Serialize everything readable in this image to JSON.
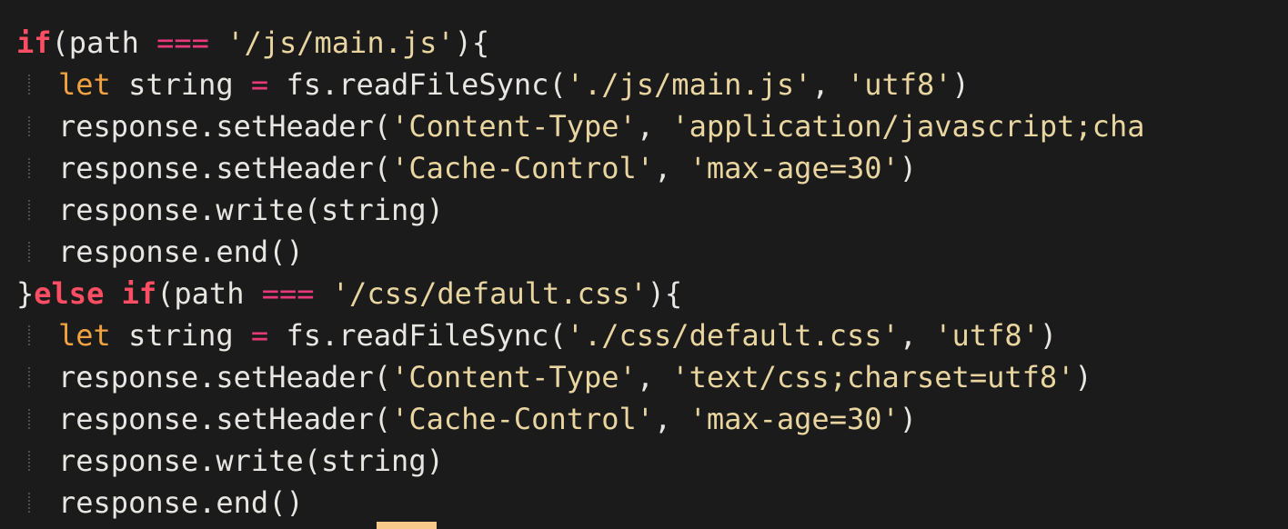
{
  "editor": {
    "lines": [
      {
        "indent": false,
        "tokens": [
          {
            "t": "kw",
            "v": "if"
          },
          {
            "t": "plain",
            "v": "(path "
          },
          {
            "t": "op",
            "v": "==="
          },
          {
            "t": "plain",
            "v": " "
          },
          {
            "t": "str",
            "v": "'/js/main.js'"
          },
          {
            "t": "plain",
            "v": "){"
          }
        ]
      },
      {
        "indent": true,
        "tokens": [
          {
            "t": "let",
            "v": "let"
          },
          {
            "t": "plain",
            "v": " string "
          },
          {
            "t": "op",
            "v": "="
          },
          {
            "t": "plain",
            "v": " fs.readFileSync("
          },
          {
            "t": "str",
            "v": "'./js/main.js'"
          },
          {
            "t": "plain",
            "v": ", "
          },
          {
            "t": "str",
            "v": "'utf8'"
          },
          {
            "t": "plain",
            "v": ")"
          }
        ]
      },
      {
        "indent": true,
        "tokens": [
          {
            "t": "plain",
            "v": "response.setHeader("
          },
          {
            "t": "str",
            "v": "'Content-Type'"
          },
          {
            "t": "plain",
            "v": ", "
          },
          {
            "t": "str",
            "v": "'application/javascript;cha"
          }
        ]
      },
      {
        "indent": true,
        "tokens": [
          {
            "t": "plain",
            "v": "response.setHeader("
          },
          {
            "t": "str",
            "v": "'Cache-Control'"
          },
          {
            "t": "plain",
            "v": ", "
          },
          {
            "t": "str",
            "v": "'max-age=30'"
          },
          {
            "t": "plain",
            "v": ")"
          }
        ]
      },
      {
        "indent": true,
        "tokens": [
          {
            "t": "plain",
            "v": "response.write(string)"
          }
        ]
      },
      {
        "indent": true,
        "tokens": [
          {
            "t": "plain",
            "v": "response.end()"
          }
        ]
      },
      {
        "indent": false,
        "tokens": [
          {
            "t": "plain",
            "v": "}"
          },
          {
            "t": "kw",
            "v": "else"
          },
          {
            "t": "plain",
            "v": " "
          },
          {
            "t": "kw",
            "v": "if"
          },
          {
            "t": "plain",
            "v": "(path "
          },
          {
            "t": "op",
            "v": "==="
          },
          {
            "t": "plain",
            "v": " "
          },
          {
            "t": "str",
            "v": "'/css/default.css'"
          },
          {
            "t": "plain",
            "v": "){"
          }
        ]
      },
      {
        "indent": true,
        "tokens": [
          {
            "t": "let",
            "v": "let"
          },
          {
            "t": "plain",
            "v": " string "
          },
          {
            "t": "op",
            "v": "="
          },
          {
            "t": "plain",
            "v": " fs.readFileSync("
          },
          {
            "t": "str",
            "v": "'./css/default.css'"
          },
          {
            "t": "plain",
            "v": ", "
          },
          {
            "t": "str",
            "v": "'utf8'"
          },
          {
            "t": "plain",
            "v": ")"
          }
        ]
      },
      {
        "indent": true,
        "tokens": [
          {
            "t": "plain",
            "v": "response.setHeader("
          },
          {
            "t": "str",
            "v": "'Content-Type'"
          },
          {
            "t": "plain",
            "v": ", "
          },
          {
            "t": "str",
            "v": "'text/css;charset=utf8'"
          },
          {
            "t": "plain",
            "v": ")"
          }
        ]
      },
      {
        "indent": true,
        "tokens": [
          {
            "t": "plain",
            "v": "response.setHeader("
          },
          {
            "t": "str",
            "v": "'Cache-Control'"
          },
          {
            "t": "plain",
            "v": ", "
          },
          {
            "t": "str",
            "v": "'max-age=30'"
          },
          {
            "t": "plain",
            "v": ")"
          }
        ]
      },
      {
        "indent": true,
        "tokens": [
          {
            "t": "plain",
            "v": "response.write(string)"
          }
        ]
      },
      {
        "indent": true,
        "tokens": [
          {
            "t": "plain",
            "v": "response.end()"
          }
        ]
      }
    ]
  },
  "colors": {
    "background": "#1b1b1b",
    "keyword": "#ff4d63",
    "let_keyword": "#f0a340",
    "operator": "#e83a7a",
    "string": "#e9d5a0",
    "text": "#e8e6e3",
    "cursor": "#f7c98a"
  }
}
